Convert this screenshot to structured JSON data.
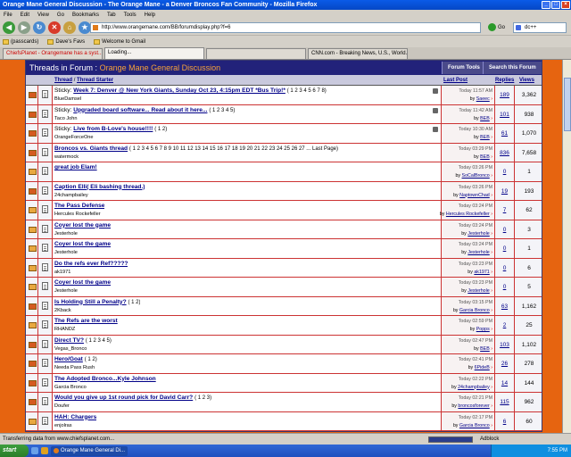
{
  "window": {
    "title": "Orange Mane General Discussion - The Orange Mane - a Denver Broncos Fan Community - Mozilla Firefox"
  },
  "menu": [
    "File",
    "Edit",
    "View",
    "Go",
    "Bookmarks",
    "Tab",
    "Tools",
    "Help"
  ],
  "nav": {
    "url": "http://www.orangemane.com/BB/forumdisplay.php?f=6",
    "go_label": "Go",
    "search_value": "dc++"
  },
  "bookmarks": [
    "(passcards)",
    "Dave's Favs",
    "Welcome to Gmail"
  ],
  "tabs": [
    {
      "label": "ChiefsPlanet - Orangemane has a syst...",
      "active": false,
      "red": true
    },
    {
      "label": "Loading...",
      "active": true,
      "red": false
    },
    {
      "label": "",
      "active": false,
      "red": false
    },
    {
      "label": "CNN.com - Breaking News, U.S., World...",
      "active": false,
      "red": false
    }
  ],
  "forum": {
    "header_prefix": "Threads in Forum",
    "header_sep": ":",
    "name": "Orange Mane General Discussion",
    "tools_label": "Forum Tools",
    "search_label": "Search this Forum",
    "col_thread": "Thread",
    "col_sep": "/",
    "col_starter": "Thread Starter",
    "col_lastpost": "Last Post",
    "col_replies": "Replies",
    "col_views": "Views"
  },
  "threads": [
    {
      "prefix": "Sticky: ",
      "title": "Week 7: Denver @ New York Giants, Sunday Oct 23, 4:15pm EDT *Bus Trip!*",
      "pages": "( 1 2 3 4 5 6 7 8)",
      "starter": "BlueDamsel",
      "date": "Today 11:57 AM",
      "by": "Saeec",
      "replies": "189",
      "views": "3,362",
      "hot": true,
      "attach": true
    },
    {
      "prefix": "Sticky: ",
      "title": "Upgraded board software... Read about it here...",
      "pages": "( 1 2 3 4 5)",
      "starter": "Taco John",
      "date": "Today 11:42 AM",
      "by": "BEB",
      "replies": "101",
      "views": "938",
      "hot": true,
      "attach": true
    },
    {
      "prefix": "Sticky: ",
      "title": "Live from B-Love's house!!!!",
      "pages": "( 1 2)",
      "starter": "OrangeForceOne",
      "date": "Today 10:30 AM",
      "by": "BEB",
      "replies": "61",
      "views": "1,070",
      "hot": true,
      "attach": true
    },
    {
      "prefix": "",
      "title": "Broncos vs. Giants thread",
      "pages": "( 1 2 3 4 5 6 7 8 9 10 11 12 13 14 15 16 17 18 19 20 21 22 23 24 25 26 27 ... Last Page)",
      "starter": "watermock",
      "date": "Today 03:29 PM",
      "by": "BEB",
      "replies": "836",
      "views": "7,658",
      "hot": true,
      "attach": false
    },
    {
      "prefix": "",
      "title": "great job Elam!",
      "pages": "",
      "starter": "",
      "date": "Today 03:26 PM",
      "by": "SoCalBronco",
      "replies": "0",
      "views": "1",
      "hot": false,
      "attach": false
    },
    {
      "prefix": "",
      "title": "Caption Elli( Eli bashing thread.)",
      "pages": "",
      "starter": "24champbailey",
      "date": "Today 03:26 PM",
      "by": "NaptownChad",
      "replies": "19",
      "views": "193",
      "hot": true,
      "attach": false
    },
    {
      "prefix": "",
      "title": "The Pass Defense",
      "pages": "",
      "starter": "Hercules Rockefeller",
      "date": "Today 03:24 PM",
      "by": "Hercules Rockefeller",
      "replies": "7",
      "views": "62",
      "hot": false,
      "attach": false
    },
    {
      "prefix": "",
      "title": "Coyer lost the game",
      "pages": "",
      "starter": "Jesterhole",
      "date": "Today 03:24 PM",
      "by": "Jesterhole",
      "replies": "0",
      "views": "3",
      "hot": false,
      "attach": false
    },
    {
      "prefix": "",
      "title": "Coyer lost the game",
      "pages": "",
      "starter": "Jesterhole",
      "date": "Today 03:24 PM",
      "by": "Jesterhole",
      "replies": "0",
      "views": "1",
      "hot": false,
      "attach": false
    },
    {
      "prefix": "",
      "title": "Do the refs ever Ref?????",
      "pages": "",
      "starter": "ak1971",
      "date": "Today 03:23 PM",
      "by": "ak1971",
      "replies": "0",
      "views": "6",
      "hot": false,
      "attach": false
    },
    {
      "prefix": "",
      "title": "Coyer lost the game",
      "pages": "",
      "starter": "Jesterhole",
      "date": "Today 03:23 PM",
      "by": "Jesterhole",
      "replies": "0",
      "views": "5",
      "hot": false,
      "attach": false
    },
    {
      "prefix": "",
      "title": "Is Holding Still a Penalty?",
      "pages": "( 1 2)",
      "starter": "2Kback",
      "date": "Today 03:15 PM",
      "by": "Garcia Bronco",
      "replies": "63",
      "views": "1,162",
      "hot": true,
      "attach": false
    },
    {
      "prefix": "",
      "title": "The Refs are the worst",
      "pages": "",
      "starter": "RHANDZ",
      "date": "Today 02:59 PM",
      "by": "Popps",
      "replies": "2",
      "views": "25",
      "hot": false,
      "attach": false
    },
    {
      "prefix": "",
      "title": "Direct TV?",
      "pages": "( 1 2 3 4 5)",
      "starter": "Vegas_Bronco",
      "date": "Today 02:47 PM",
      "by": "BEB",
      "replies": "103",
      "views": "1,102",
      "hot": true,
      "attach": false
    },
    {
      "prefix": "",
      "title": "Hero/Goat",
      "pages": "( 1 2)",
      "starter": "Needa Pass Rush",
      "date": "Today 02:41 PM",
      "by": "6PideB",
      "replies": "26",
      "views": "278",
      "hot": true,
      "attach": false
    },
    {
      "prefix": "",
      "title": "The Adopted Bronco...Kyle Johnson",
      "pages": "",
      "starter": "Garcia Bronco",
      "date": "Today 02:22 PM",
      "by": "24champbailey",
      "replies": "14",
      "views": "144",
      "hot": true,
      "attach": false
    },
    {
      "prefix": "",
      "title": "Would you give up 1st round pick for David Carr?",
      "pages": "( 1 2 3)",
      "starter": "Doufer",
      "date": "Today 02:21 PM",
      "by": "broncosforever",
      "replies": "115",
      "views": "962",
      "hot": true,
      "attach": false
    },
    {
      "prefix": "",
      "title": "HAH: Chargers",
      "pages": "",
      "starter": "enjolras",
      "date": "Today 02:17 PM",
      "by": "Garcia Bronco",
      "replies": "6",
      "views": "60",
      "hot": false,
      "attach": false
    }
  ],
  "status": {
    "text": "Transferring data from www.chiefsplanet.com...",
    "adblock": "Adblock"
  },
  "taskbar": {
    "start_label": "start",
    "task_label": "Orange Mane General Di...",
    "clock": "7:55 PM"
  }
}
